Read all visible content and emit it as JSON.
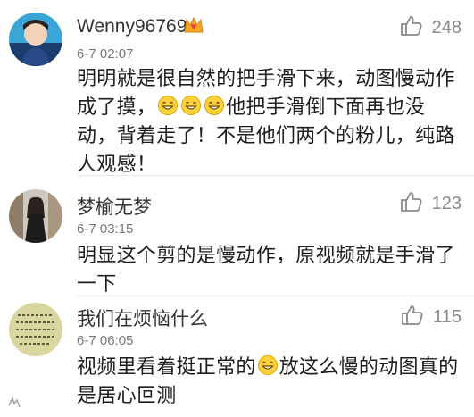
{
  "comments": [
    {
      "username": "Wenny96769",
      "time": "6-7 02:07",
      "likes": "248",
      "text": "明明就是很自然的把手滑下来，动图慢动作成了摸，",
      "text_after": "他把手滑倒下面再也没动，背着走了！不是他们两个的粉儿，纯路人观感！",
      "emoji_count": 3
    },
    {
      "username": "梦榆无梦",
      "time": "6-7 03:15",
      "likes": "123",
      "text": "明显这个剪的是慢动作，原视频就是手滑了一下"
    },
    {
      "username": "我们在烦恼什么",
      "time": "6-7 06:05",
      "likes": "115",
      "text": "视频里看着挺正常的",
      "text_after": "放这么慢的动图真的是居心叵测",
      "emoji_count": 1
    }
  ],
  "icons": {
    "like": "thumbs-up-icon",
    "badge": "crown-badge-icon",
    "emoji": "grin-emoji-icon"
  },
  "colors": {
    "like_icon": "#8a8a8a",
    "badge": "#f5a623",
    "badge_heart": "#e8453c",
    "emoji": "#ffd13b"
  }
}
